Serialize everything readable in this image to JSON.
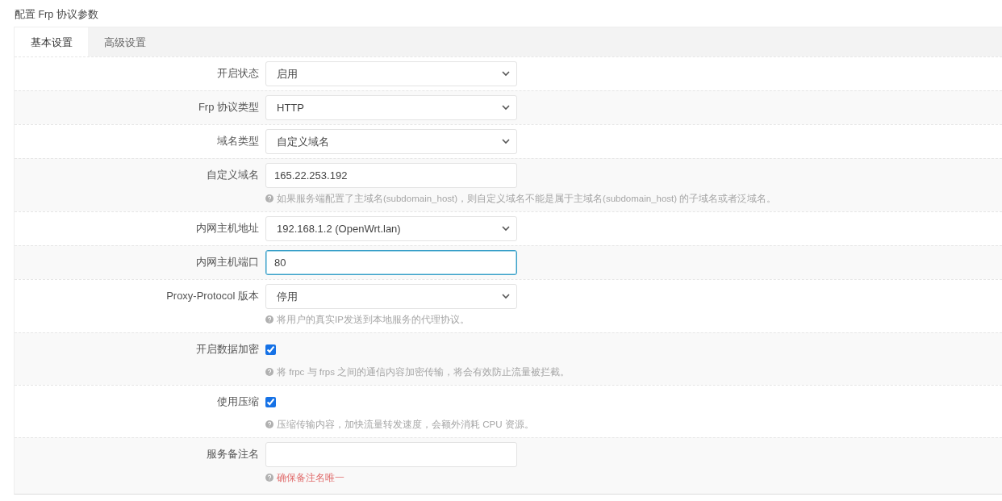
{
  "section_title": "配置 Frp 协议参数",
  "tabs": [
    {
      "label": "基本设置",
      "selected": true
    },
    {
      "label": "高级设置",
      "selected": false
    }
  ],
  "rows": [
    {
      "kind": "select",
      "label": "开启状态",
      "value": "启用"
    },
    {
      "kind": "select",
      "label": "Frp 协议类型",
      "value": "HTTP"
    },
    {
      "kind": "select",
      "label": "域名类型",
      "value": "自定义域名"
    },
    {
      "kind": "text",
      "label": "自定义域名",
      "value": "165.22.253.192",
      "focused": false,
      "hint": {
        "text": "如果服务端配置了主域名(subdomain_host)，则自定义域名不能是属于主域名(subdomain_host) 的子域名或者泛域名。",
        "error": false
      }
    },
    {
      "kind": "select",
      "label": "内网主机地址",
      "value": "192.168.1.2 (OpenWrt.lan)"
    },
    {
      "kind": "text",
      "label": "内网主机端口",
      "value": "80",
      "focused": true
    },
    {
      "kind": "select",
      "label": "Proxy-Protocol 版本",
      "value": "停用",
      "hint": {
        "text": "将用户的真实IP发送到本地服务的代理协议。",
        "error": false
      }
    },
    {
      "kind": "checkbox",
      "label": "开启数据加密",
      "checked": true,
      "hint": {
        "text": "将 frpc 与 frps 之间的通信内容加密传输，将会有效防止流量被拦截。",
        "error": false
      }
    },
    {
      "kind": "checkbox",
      "label": "使用压缩",
      "checked": true,
      "hint": {
        "text": "压缩传输内容，加快流量转发速度，会额外消耗 CPU 资源。",
        "error": false
      }
    },
    {
      "kind": "text",
      "label": "服务备注名",
      "value": "",
      "focused": false,
      "hint": {
        "text": "确保备注名唯一",
        "error": true
      }
    }
  ]
}
